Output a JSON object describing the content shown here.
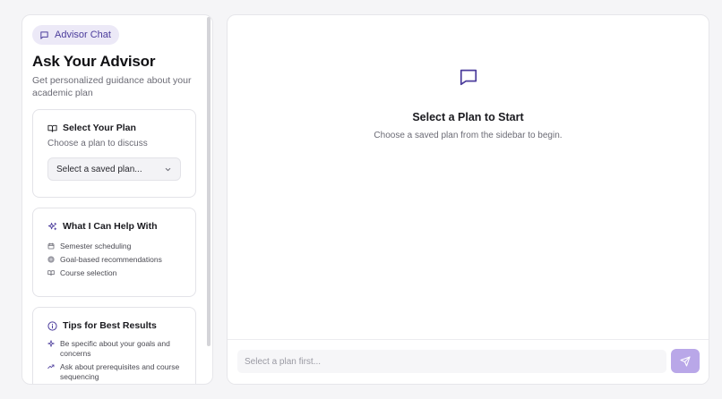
{
  "sidebar": {
    "pill_label": "Advisor Chat",
    "title": "Ask Your Advisor",
    "subtitle": "Get personalized guidance about your academic plan",
    "plan_card": {
      "title": "Select Your Plan",
      "subtitle": "Choose a plan to discuss",
      "select_value": "Select a saved plan..."
    },
    "help_card": {
      "title": "What I Can Help With",
      "items": [
        {
          "label": "Semester scheduling",
          "icon": "calendar-icon"
        },
        {
          "label": "Goal-based recommendations",
          "icon": "target-icon"
        },
        {
          "label": "Course selection",
          "icon": "book-icon"
        }
      ]
    },
    "tips_card": {
      "title": "Tips for Best Results",
      "items": [
        {
          "label": "Be specific about your goals and concerns",
          "icon": "sparkle-icon"
        },
        {
          "label": "Ask about prerequisites and course sequencing",
          "icon": "trend-icon"
        }
      ]
    }
  },
  "main": {
    "empty_title": "Select a Plan to Start",
    "empty_subtitle": "Choose a saved plan from the sidebar to begin.",
    "input_placeholder": "Select a plan first..."
  },
  "colors": {
    "accent": "#4c3d9c",
    "accent_soft": "#ece9f7",
    "send_button": "#b9a7e8"
  }
}
